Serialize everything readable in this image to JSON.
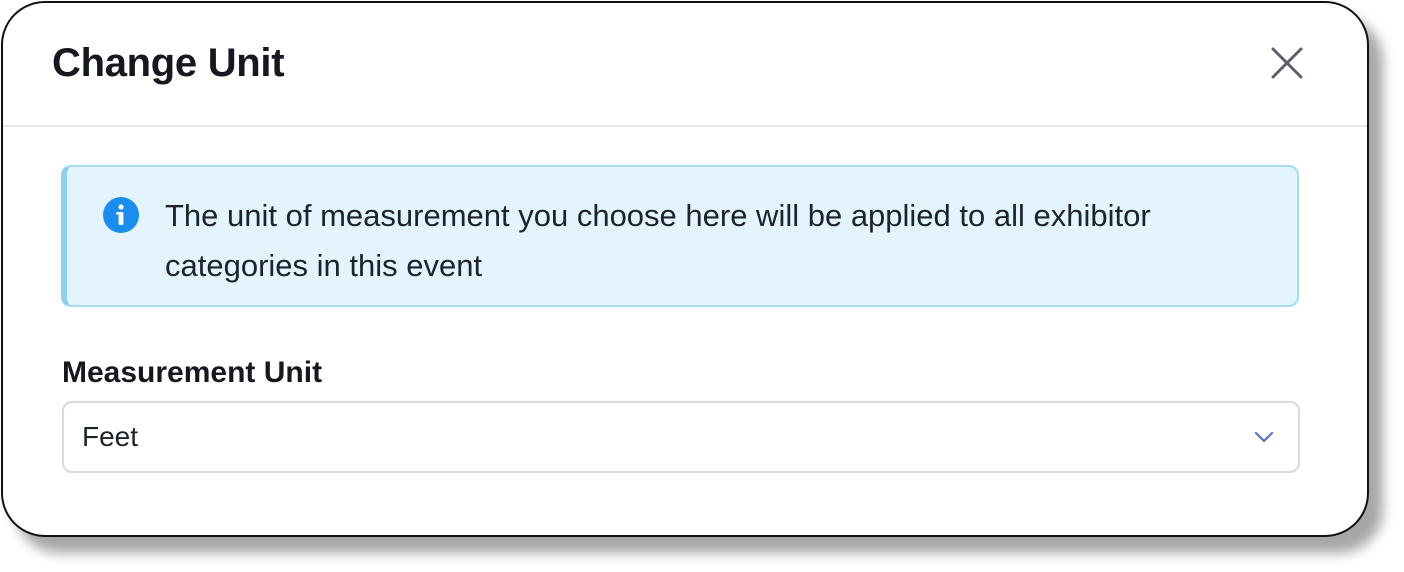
{
  "dialog": {
    "title": "Change Unit",
    "close_icon": "close-icon"
  },
  "info": {
    "icon": "info-icon",
    "message": "The unit of measurement you choose here will be applied to all exhibitor categories in this event"
  },
  "measurement_unit": {
    "label": "Measurement Unit",
    "selected": "Feet",
    "dropdown_icon": "chevron-down-icon"
  },
  "colors": {
    "info_background": "#e3f4fc",
    "info_border": "#a6daf5",
    "info_icon": "#1a8ef0",
    "chevron": "#5b6bd6"
  }
}
